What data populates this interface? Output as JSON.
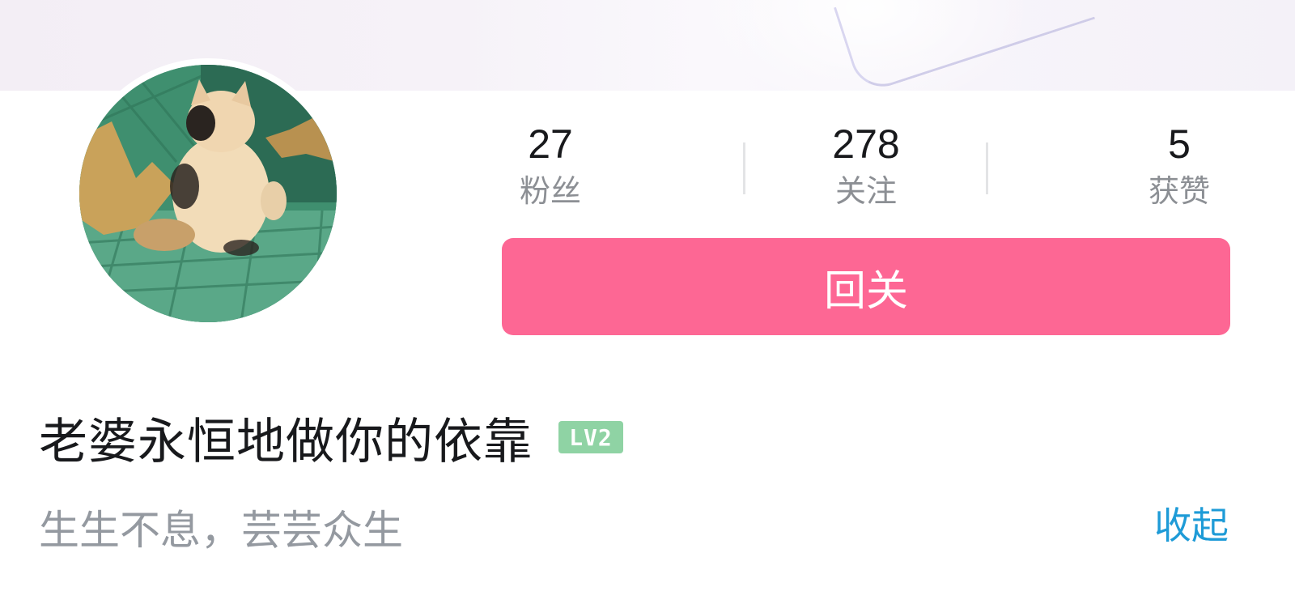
{
  "profile": {
    "username": "老婆永恒地做你的依靠",
    "level": "LV2",
    "bio": "生生不息，芸芸众生",
    "collapse_label": "收起"
  },
  "stats": {
    "fans": {
      "value": "27",
      "label": "粉丝"
    },
    "following": {
      "value": "278",
      "label": "关注"
    },
    "likes": {
      "value": "5",
      "label": "获赞"
    }
  },
  "actions": {
    "follow_back_label": "回关"
  },
  "colors": {
    "accent_pink": "#fd6794",
    "link_blue": "#1e9bd7",
    "level_green": "#8fd3a4",
    "text_primary": "#18191c",
    "text_secondary": "#9499a0"
  },
  "icons": {
    "avatar": "cat-photo-avatar"
  }
}
